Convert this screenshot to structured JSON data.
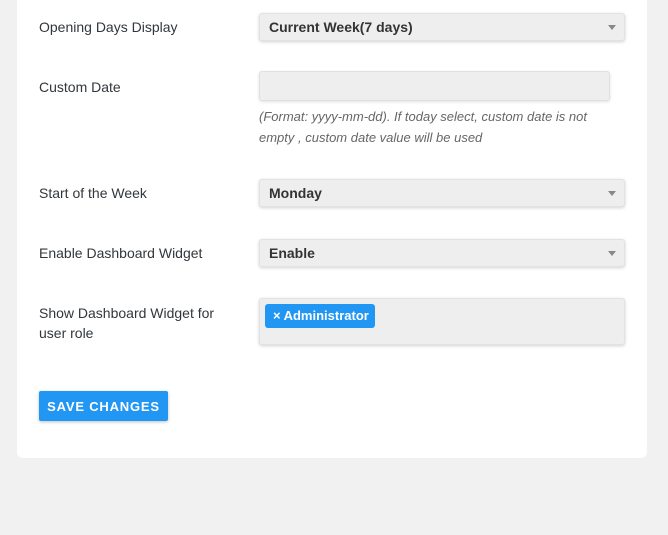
{
  "settings": {
    "opening_days": {
      "label": "Opening Days Display",
      "value": "Current Week(7 days)"
    },
    "custom_date": {
      "label": "Custom Date",
      "value": "",
      "placeholder": "",
      "hint": "(Format: yyyy-mm-dd). If today select, custom date is not empty , custom date value will be used"
    },
    "start_of_week": {
      "label": "Start of the Week",
      "value": "Monday"
    },
    "dashboard_widget": {
      "label": "Enable Dashboard Widget",
      "value": "Enable"
    },
    "widget_roles": {
      "label": "Show Dashboard Widget for user role",
      "tags": [
        {
          "remove": "×",
          "label": "Administrator"
        }
      ]
    }
  },
  "actions": {
    "save_label": "SAVE CHANGES"
  },
  "colors": {
    "accent": "#2196f3",
    "background": "#f1f1f1",
    "card": "#ffffff",
    "field": "#eeeeee"
  },
  "icons": {
    "select_arrow": "triangle-down-icon",
    "tag_remove": "close-icon"
  }
}
